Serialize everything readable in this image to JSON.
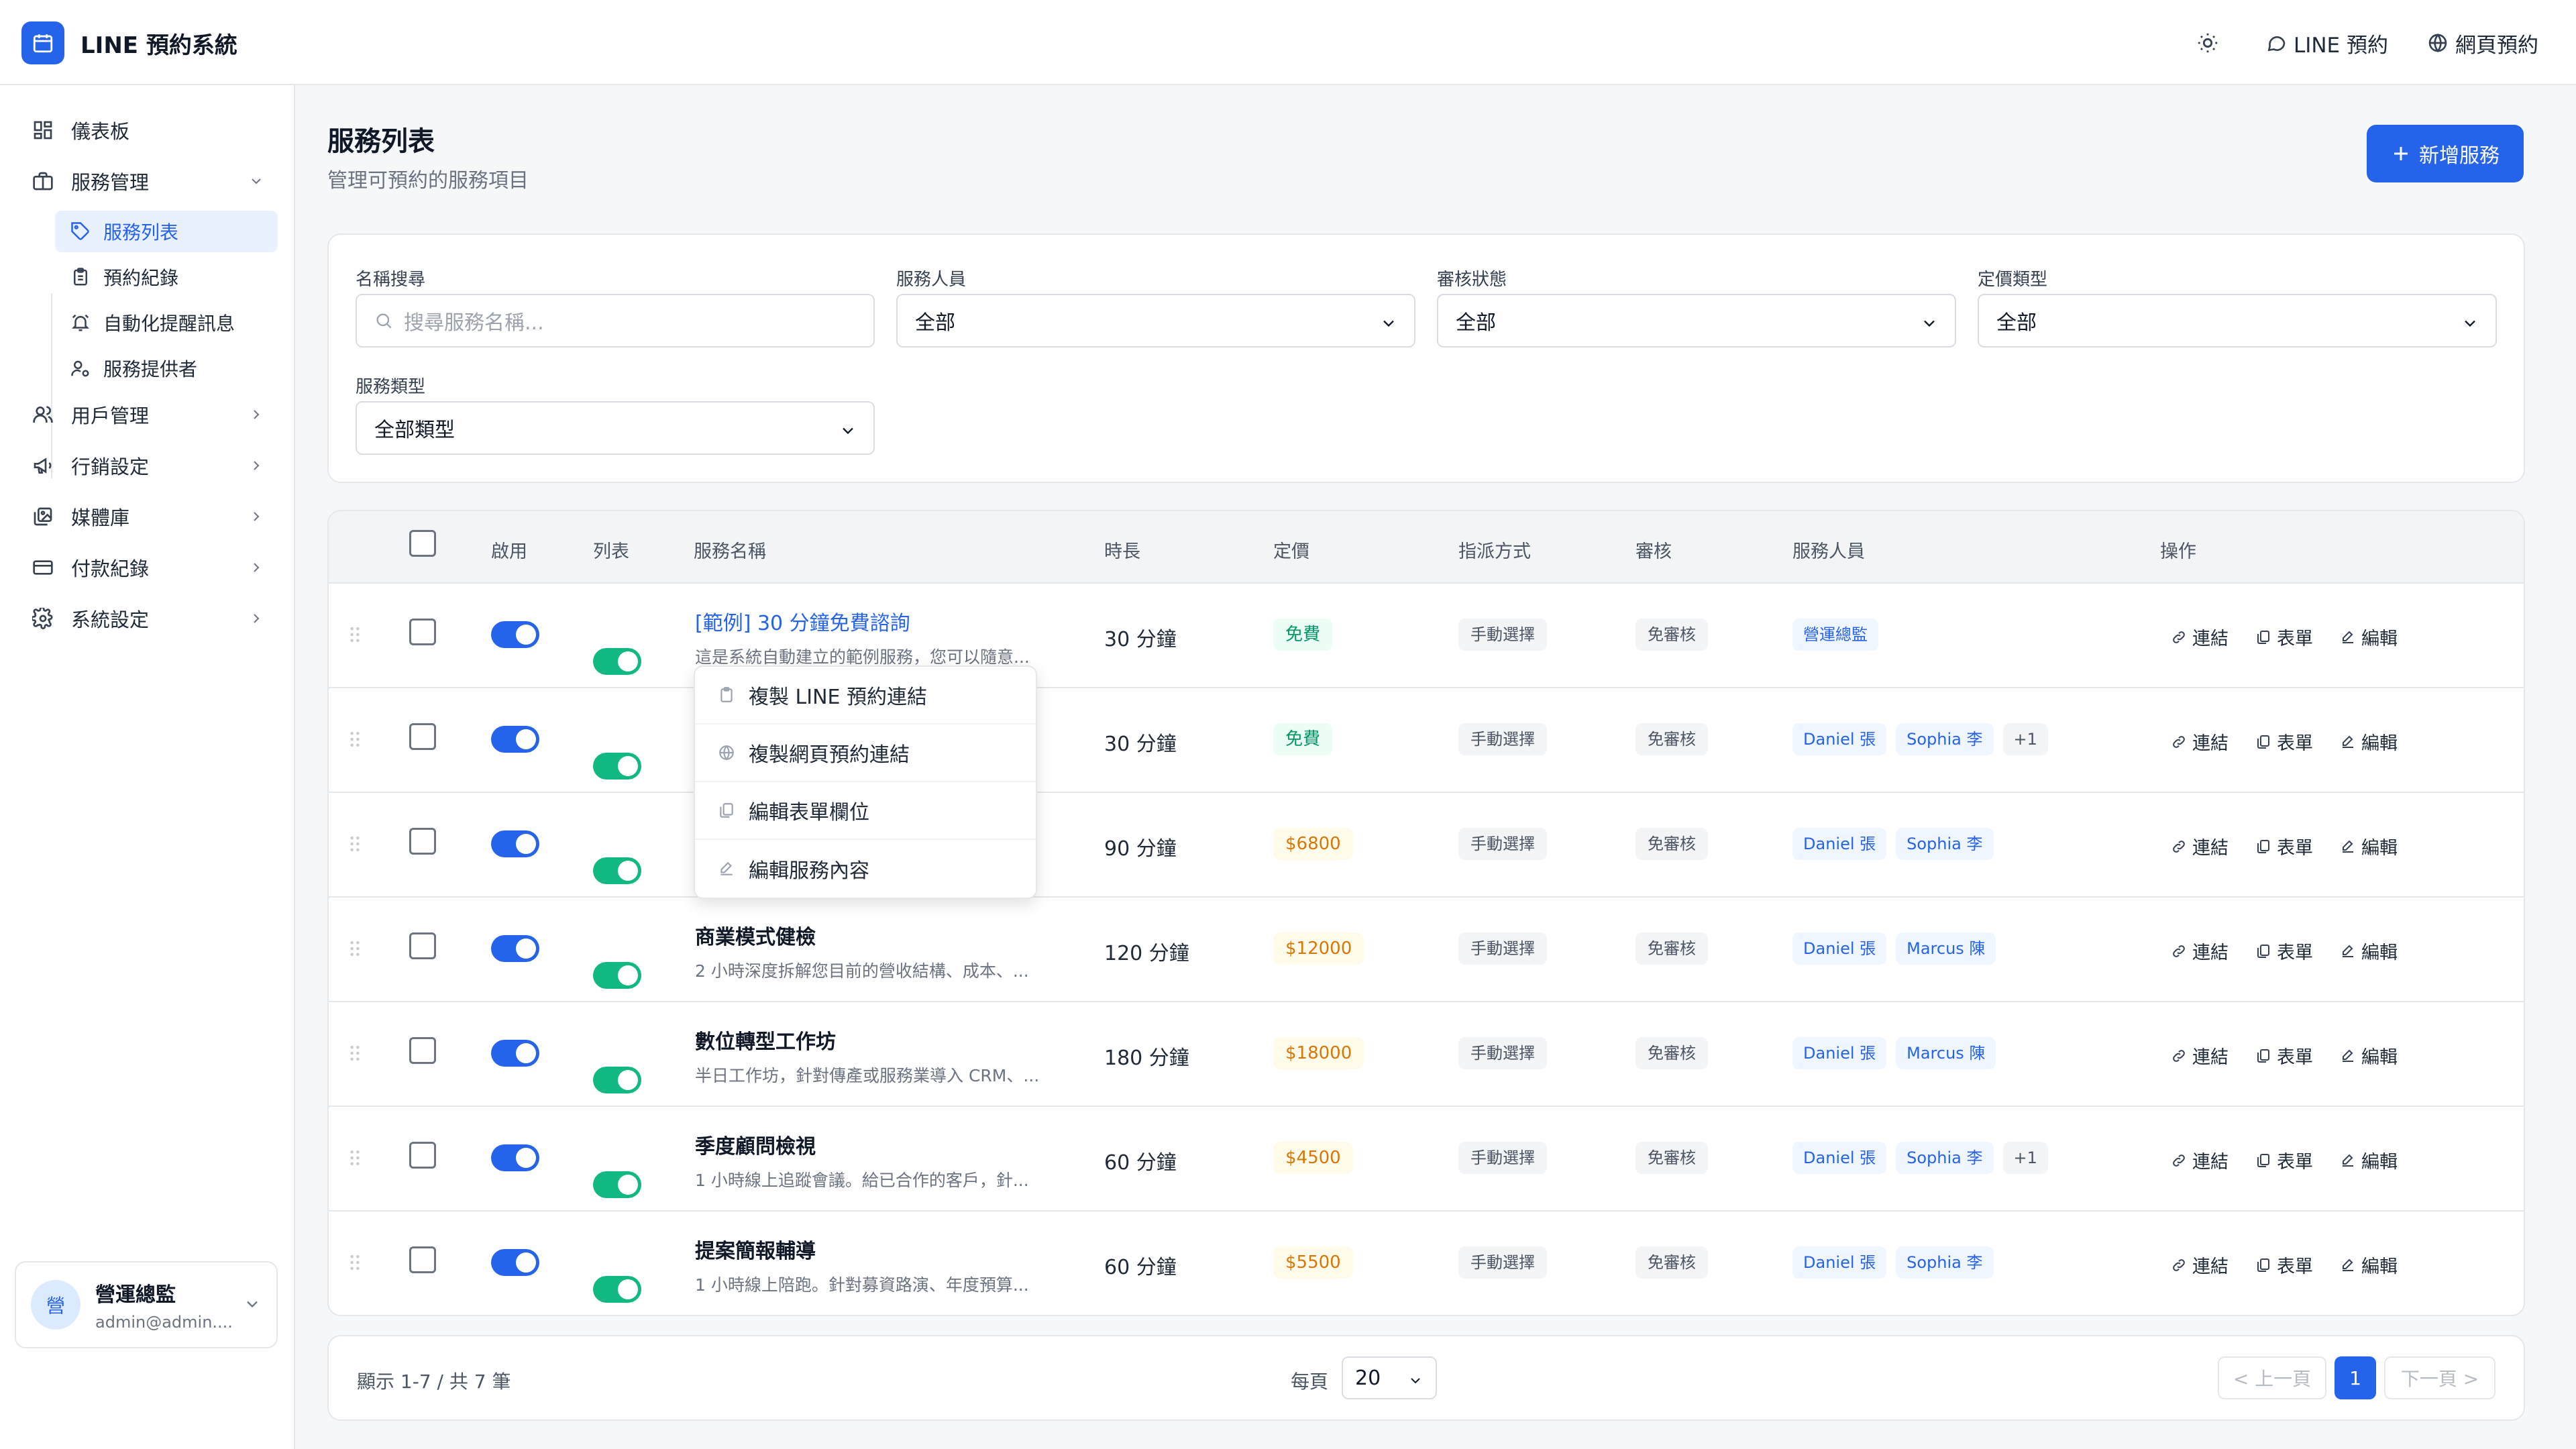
{
  "app": {
    "title": "LINE 預約系統"
  },
  "topbar": {
    "line_booking": "LINE 預約",
    "web_booking": "網頁預約"
  },
  "sidebar": {
    "dashboard": "儀表板",
    "service_mgmt": "服務管理",
    "sub": [
      "服務列表",
      "預約紀錄",
      "自動化提醒訊息",
      "服務提供者"
    ],
    "user_mgmt": "用戶管理",
    "marketing": "行銷設定",
    "media": "媒體庫",
    "payments": "付款紀錄",
    "settings": "系統設定"
  },
  "user": {
    "avatar": "營",
    "name": "營運總監",
    "email": "admin@admin...."
  },
  "page": {
    "title": "服務列表",
    "subtitle": "管理可預約的服務項目",
    "add_button": "新增服務"
  },
  "filters": {
    "name_label": "名稱搜尋",
    "name_placeholder": "搜尋服務名稱...",
    "staff_label": "服務人員",
    "staff_value": "全部",
    "review_label": "審核狀態",
    "review_value": "全部",
    "pricing_label": "定價類型",
    "pricing_value": "全部",
    "type_label": "服務類型",
    "type_value": "全部類型"
  },
  "table": {
    "headers": [
      "啟用",
      "列表",
      "服務名稱",
      "時長",
      "定價",
      "指派方式",
      "審核",
      "服務人員",
      "操作"
    ],
    "ops": {
      "link": "連結",
      "form": "表單",
      "edit": "編輯"
    },
    "rows": [
      {
        "name": "[範例] 30 分鐘免費諮詢",
        "desc": "這是系統自動建立的範例服務，您可以隨意...",
        "duration": "30 分鐘",
        "price": "免費",
        "assign": "手動選擇",
        "review": "免審核",
        "staff": [
          "營運總監"
        ],
        "more": ""
      },
      {
        "name": "",
        "desc": "",
        "duration": "30 分鐘",
        "price": "免費",
        "assign": "手動選擇",
        "review": "免審核",
        "staff": [
          "Daniel 張",
          "Sophia 李"
        ],
        "more": "+1"
      },
      {
        "name": "",
        "desc": "...",
        "duration": "90 分鐘",
        "price": "$6800",
        "assign": "手動選擇",
        "review": "免審核",
        "staff": [
          "Daniel 張",
          "Sophia 李"
        ],
        "more": ""
      },
      {
        "name": "商業模式健檢",
        "desc": "2 小時深度拆解您目前的營收結構、成本、...",
        "duration": "120 分鐘",
        "price": "$12000",
        "assign": "手動選擇",
        "review": "免審核",
        "staff": [
          "Daniel 張",
          "Marcus 陳"
        ],
        "more": ""
      },
      {
        "name": "數位轉型工作坊",
        "desc": "半日工作坊，針對傳產或服務業導入 CRM、...",
        "duration": "180 分鐘",
        "price": "$18000",
        "assign": "手動選擇",
        "review": "免審核",
        "staff": [
          "Daniel 張",
          "Marcus 陳"
        ],
        "more": ""
      },
      {
        "name": "季度顧問檢視",
        "desc": "1 小時線上追蹤會議。給已合作的客戶，針...",
        "duration": "60 分鐘",
        "price": "$4500",
        "assign": "手動選擇",
        "review": "免審核",
        "staff": [
          "Daniel 張",
          "Sophia 李"
        ],
        "more": "+1"
      },
      {
        "name": "提案簡報輔導",
        "desc": "1 小時線上陪跑。針對募資路演、年度預算...",
        "duration": "60 分鐘",
        "price": "$5500",
        "assign": "手動選擇",
        "review": "免審核",
        "staff": [
          "Daniel 張",
          "Sophia 李"
        ],
        "more": ""
      }
    ]
  },
  "context_menu": [
    "複製 LINE 預約連結",
    "複製網頁預約連結",
    "編輯表單欄位",
    "編輯服務內容"
  ],
  "footer": {
    "count": "顯示 1-7 / 共 7 筆",
    "per_page_label": "每頁",
    "per_page": "20",
    "prev": "< 上一頁",
    "page": "1",
    "next": "下一頁 >"
  },
  "colors": {
    "accent": "#2563eb",
    "success": "#10b981",
    "price": "#d97706"
  }
}
